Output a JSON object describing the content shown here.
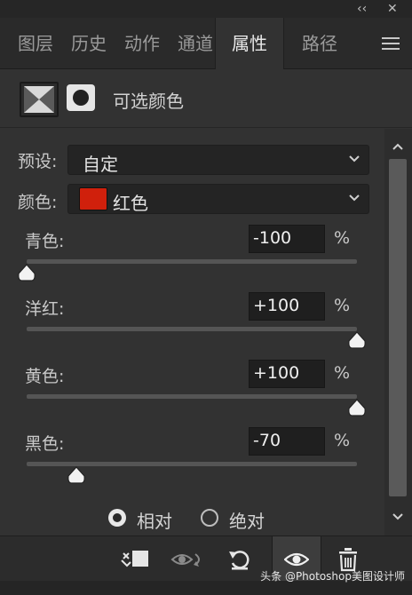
{
  "window": {
    "collapse_label": "‹‹",
    "close_label": "✕"
  },
  "tabs": [
    {
      "label": "图层"
    },
    {
      "label": "历史"
    },
    {
      "label": "动作"
    },
    {
      "label": "通道"
    },
    {
      "label": "属性",
      "active": true
    },
    {
      "label": "路径"
    }
  ],
  "adjustment": {
    "title": "可选颜色"
  },
  "preset": {
    "label": "预设:",
    "value": "自定"
  },
  "colors": {
    "label": "颜色:",
    "value": "红色",
    "swatch_color": "#d0200c"
  },
  "sliders": [
    {
      "label": "青色:",
      "value": "-100",
      "unit": "%",
      "level": 0.0
    },
    {
      "label": "洋红:",
      "value": "+100",
      "unit": "%",
      "level": 1.0
    },
    {
      "label": "黄色:",
      "value": "+100",
      "unit": "%",
      "level": 1.0
    },
    {
      "label": "黑色:",
      "value": "-70",
      "unit": "%",
      "level": 0.15
    }
  ],
  "method": {
    "relative_label": "相对",
    "absolute_label": "绝对",
    "selected": "relative"
  },
  "watermark": "头条 @Photoshop美图设计师"
}
